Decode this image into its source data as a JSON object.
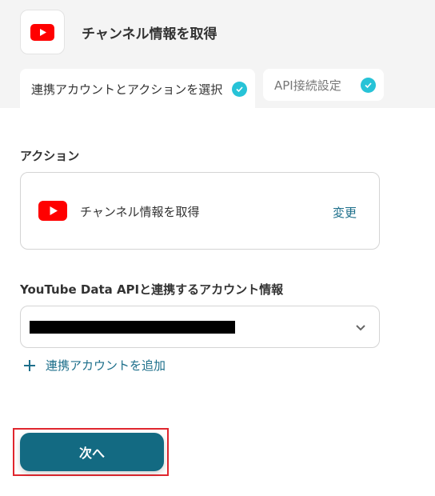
{
  "header": {
    "app_icon": "youtube-icon",
    "title": "チャンネル情報を取得"
  },
  "tabs": [
    {
      "label": "連携アカウントとアクションを選択",
      "completed": true,
      "active": true
    },
    {
      "label": "API接続設定",
      "completed": true,
      "active": false
    }
  ],
  "action_section": {
    "label": "アクション",
    "app_icon": "youtube-icon",
    "action_name": "チャンネル情報を取得",
    "change_label": "変更"
  },
  "account_section": {
    "label": "YouTube Data APIと連携するアカウント情報",
    "selected_value": "[redacted]",
    "dropdown_icon": "chevron-down-icon",
    "add_account_label": "連携アカウントを追加"
  },
  "footer": {
    "next_label": "次へ"
  },
  "colors": {
    "accent": "#136a82",
    "link": "#1d6f8b",
    "check": "#27c3d7",
    "youtube_red": "#ff0000",
    "highlight": "#e0262e"
  }
}
